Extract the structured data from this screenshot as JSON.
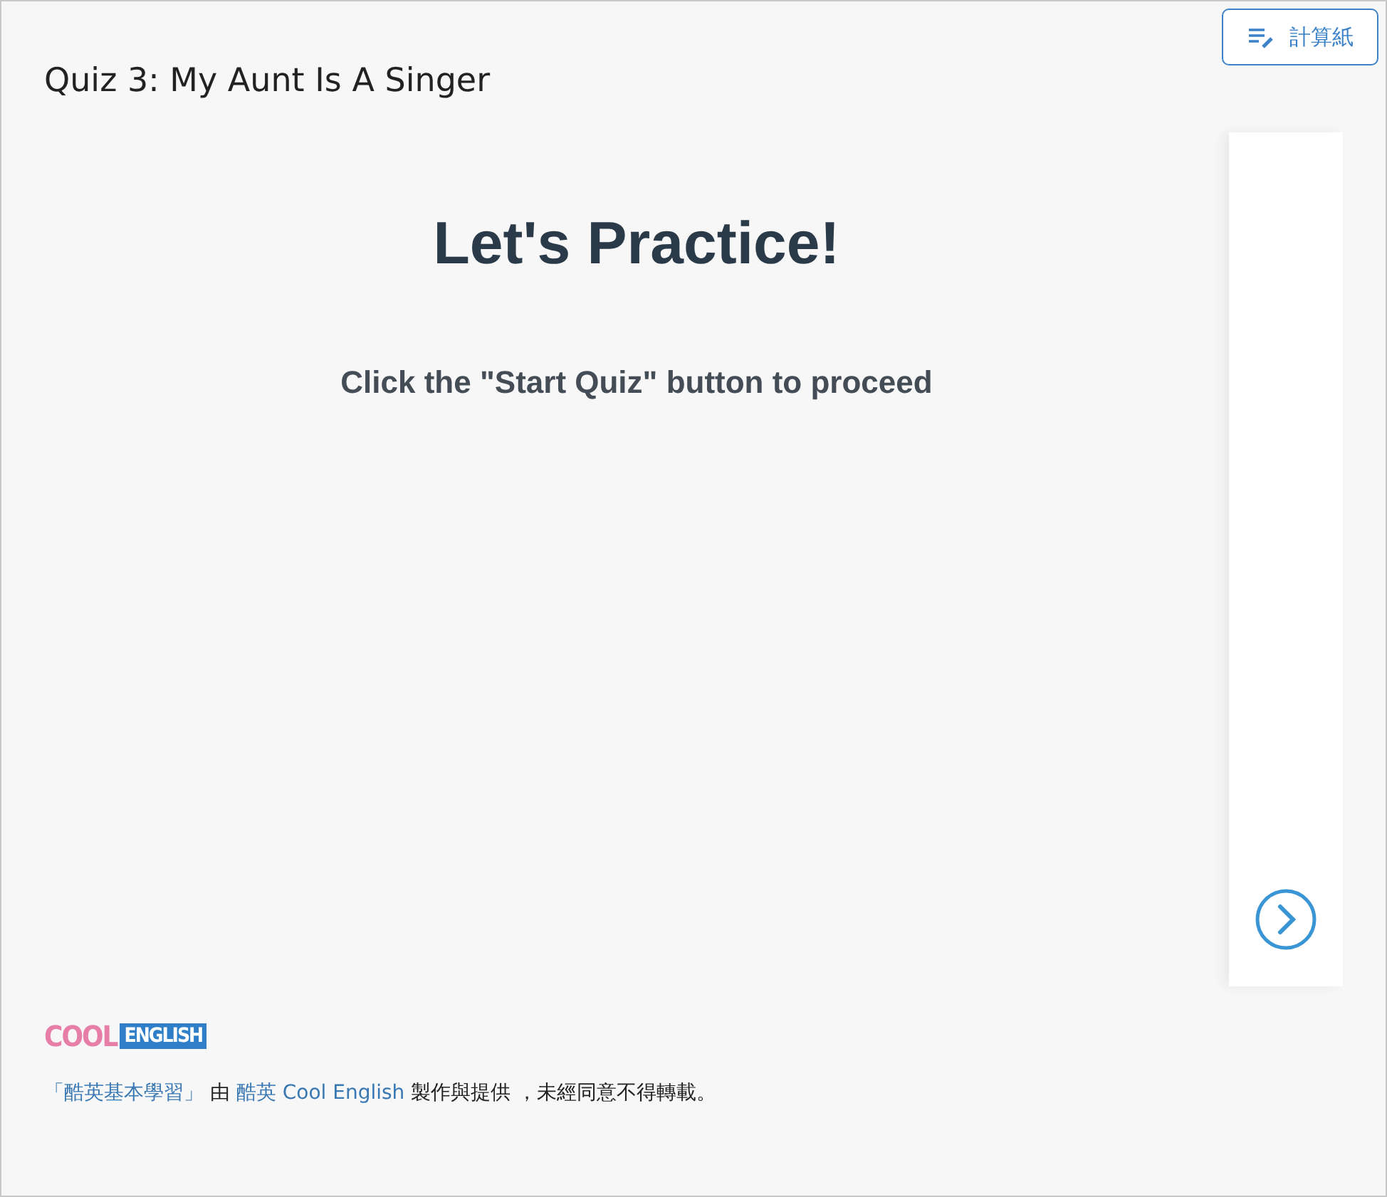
{
  "toolbar": {
    "scratch_button": {
      "label": "計算紙"
    }
  },
  "title": "Quiz 3: My Aunt Is A Singer",
  "quiz": {
    "heading": "Let's Practice!",
    "instruction": "Click the \"Start Quiz\" button to proceed"
  },
  "footer": {
    "logo": {
      "part_1": "COOL",
      "part_2": "ENGLISH"
    },
    "credit": [
      {
        "kind": "link",
        "text": "「酷英基本學習」"
      },
      {
        "kind": "text",
        "text": " 由 "
      },
      {
        "kind": "link",
        "text": "酷英 Cool English"
      },
      {
        "kind": "text",
        "text": " 製作與提供 ，未經同意不得轉載。"
      }
    ]
  }
}
